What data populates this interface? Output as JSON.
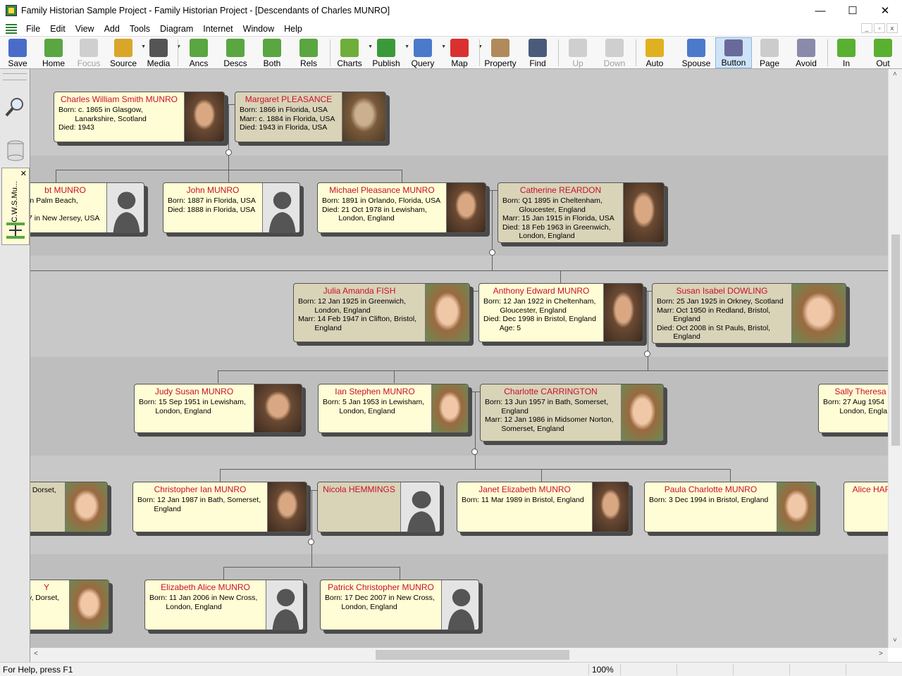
{
  "window": {
    "title": "Family Historian Sample Project - Family Historian Project - [Descendants of Charles MUNRO]",
    "minimize": "—",
    "maximize": "☐",
    "close": "✕"
  },
  "menu": [
    "File",
    "Edit",
    "View",
    "Add",
    "Tools",
    "Diagram",
    "Internet",
    "Window",
    "Help"
  ],
  "mdi": {
    "min": "_",
    "restore": "▫",
    "close": "x"
  },
  "toolbar": [
    {
      "label": "Save",
      "icon": "save-icon",
      "color": "#4a6cc9"
    },
    {
      "label": "Home",
      "icon": "home-icon",
      "color": "#5aa640"
    },
    {
      "label": "Focus",
      "icon": "magnifier-icon",
      "color": "#cfcfcf",
      "disabled": true
    },
    {
      "label": "Source",
      "icon": "source-icon",
      "color": "#d9a62a",
      "dropdown": true
    },
    {
      "label": "Media",
      "icon": "camera-icon",
      "color": "#555555",
      "dropdown": true
    },
    {
      "label": "Ancs",
      "icon": "ancestors-icon",
      "color": "#5aa640"
    },
    {
      "label": "Descs",
      "icon": "descendants-icon",
      "color": "#5aa640"
    },
    {
      "label": "Both",
      "icon": "both-icon",
      "color": "#5aa640"
    },
    {
      "label": "Rels",
      "icon": "relatives-icon",
      "color": "#5aa640"
    },
    {
      "label": "Charts",
      "icon": "charts-icon",
      "color": "#6fae3a",
      "dropdown": true
    },
    {
      "label": "Publish",
      "icon": "publish-icon",
      "color": "#3a9a3a",
      "dropdown": true
    },
    {
      "label": "Query",
      "icon": "query-icon",
      "color": "#4a7ac9",
      "dropdown": true
    },
    {
      "label": "Map",
      "icon": "map-pin-icon",
      "color": "#d93030",
      "dropdown": true
    },
    {
      "label": "Property",
      "icon": "property-icon",
      "color": "#b08a5a"
    },
    {
      "label": "Find",
      "icon": "binoculars-icon",
      "color": "#4a5a7a"
    },
    {
      "label": "Up",
      "icon": "up-arrow-icon",
      "color": "#cfcfcf",
      "disabled": true
    },
    {
      "label": "Down",
      "icon": "down-arrow-icon",
      "color": "#cfcfcf",
      "disabled": true
    },
    {
      "label": "Auto",
      "icon": "auto-icon",
      "color": "#e0b020"
    },
    {
      "label": "Spouse",
      "icon": "spouse-icon",
      "color": "#4a7ac9",
      "dropdown": true
    },
    {
      "label": "Button",
      "icon": "button-icon",
      "color": "#6a6a9a",
      "active": true
    },
    {
      "label": "Page",
      "icon": "page-icon",
      "color": "#cccccc"
    },
    {
      "label": "Avoid",
      "icon": "avoid-icon",
      "color": "#8a8aaa"
    },
    {
      "label": "In",
      "icon": "zoom-in-icon",
      "color": "#5ab030"
    },
    {
      "label": "Out",
      "icon": "zoom-out-icon",
      "color": "#5ab030"
    }
  ],
  "side_panel": {
    "tab_label": "C.W.S.Mu...",
    "close": "✕"
  },
  "people": [
    {
      "id": "charles",
      "name": "Charles William Smith MUNRO",
      "details": "Born: c. 1865 in Glasgow,\n        Lanarkshire, Scotland\nDied: 1943"
    },
    {
      "id": "margaret",
      "name": "Margaret  PLEASANCE",
      "details": "Born: 1866 in Florida, USA\nMarr: c. 1884 in Florida, USA\nDied: 1943 in Florida, USA"
    },
    {
      "id": "robert",
      "name": "bt MUNRO",
      "details": "in Palm Beach,\n\n7 in New Jersey, USA"
    },
    {
      "id": "john",
      "name": "John MUNRO",
      "details": "Born: 1887 in Florida, USA\nDied: 1888 in Florida, USA"
    },
    {
      "id": "michael",
      "name": "Michael Pleasance MUNRO",
      "details": "Born: 1891 in Orlando, Florida, USA\nDied: 21 Oct 1978 in Lewisham,\n        London, England"
    },
    {
      "id": "catherine",
      "name": "Catherine REARDON",
      "details": "Born: Q1 1895 in Cheltenham,\n        Gloucester, England\nMarr: 15 Jan 1915 in Florida, USA\nDied: 18 Feb 1963 in Greenwich,\n        London, England"
    },
    {
      "id": "julia",
      "name": "Julia Amanda FISH",
      "details": "Born: 12 Jan 1925 in Greenwich,\n        London, England\nMarr: 14 Feb 1947 in Clifton, Bristol,\n        England"
    },
    {
      "id": "anthony",
      "name": "Anthony Edward MUNRO",
      "details": "Born: 12 Jan 1922 in Cheltenham,\n        Gloucester, England\nDied: Dec 1998 in Bristol, England\n        Age: 5"
    },
    {
      "id": "susan",
      "name": "Susan Isabel DOWLING",
      "details": "Born: 25 Jan 1925 in Orkney, Scotland\nMarr: Oct 1950 in Redland, Bristol,\n        England\nDied: Oct 2008 in St Pauls, Bristol,\n        England"
    },
    {
      "id": "judy",
      "name": "Judy Susan MUNRO",
      "details": "Born: 15 Sep 1951 in Lewisham,\n        London, England"
    },
    {
      "id": "ian",
      "name": "Ian Stephen MUNRO",
      "details": "Born: 5 Jan 1953 in Lewisham,\n        London, England"
    },
    {
      "id": "charlotte",
      "name": "Charlotte CARRINGTON",
      "details": "Born: 13 Jun 1957 in Bath, Somerset,\n        England\nMarr: 12 Jan 1986 in Midsomer Norton,\n        Somerset, England"
    },
    {
      "id": "sally",
      "name": "Sally Theresa",
      "details": "Born: 27 Aug 1954\n        London, Engla"
    },
    {
      "id": "left4",
      "name": "",
      "details": ", Dorset,"
    },
    {
      "id": "christopher",
      "name": "Christopher Ian MUNRO",
      "details": "Born: 12 Jan 1987 in Bath, Somerset,\n        England"
    },
    {
      "id": "nicola",
      "name": "Nicola HEMMINGS",
      "details": ""
    },
    {
      "id": "janet",
      "name": "Janet Elizabeth MUNRO",
      "details": "Born: 11 Mar 1989 in Bristol, England"
    },
    {
      "id": "paula",
      "name": "Paula Charlotte MUNRO",
      "details": "Born: 3 Dec 1994 in Bristol, England"
    },
    {
      "id": "alice",
      "name": "Alice HAR",
      "details": ""
    },
    {
      "id": "left5",
      "name": "Y",
      "details": "y, Dorset,"
    },
    {
      "id": "elizabeth",
      "name": "Elizabeth Alice MUNRO",
      "details": "Born: 11 Jan 2006 in New Cross,\n        London, England"
    },
    {
      "id": "patrick",
      "name": "Patrick Christopher MUNRO",
      "details": "Born: 17 Dec 2007 in New Cross,\n        London, England"
    }
  ],
  "status": {
    "help": "For Help, press F1",
    "zoom": "100%"
  },
  "scroll": {
    "left": "<",
    "right": ">",
    "up": "˄",
    "down": "˅"
  }
}
